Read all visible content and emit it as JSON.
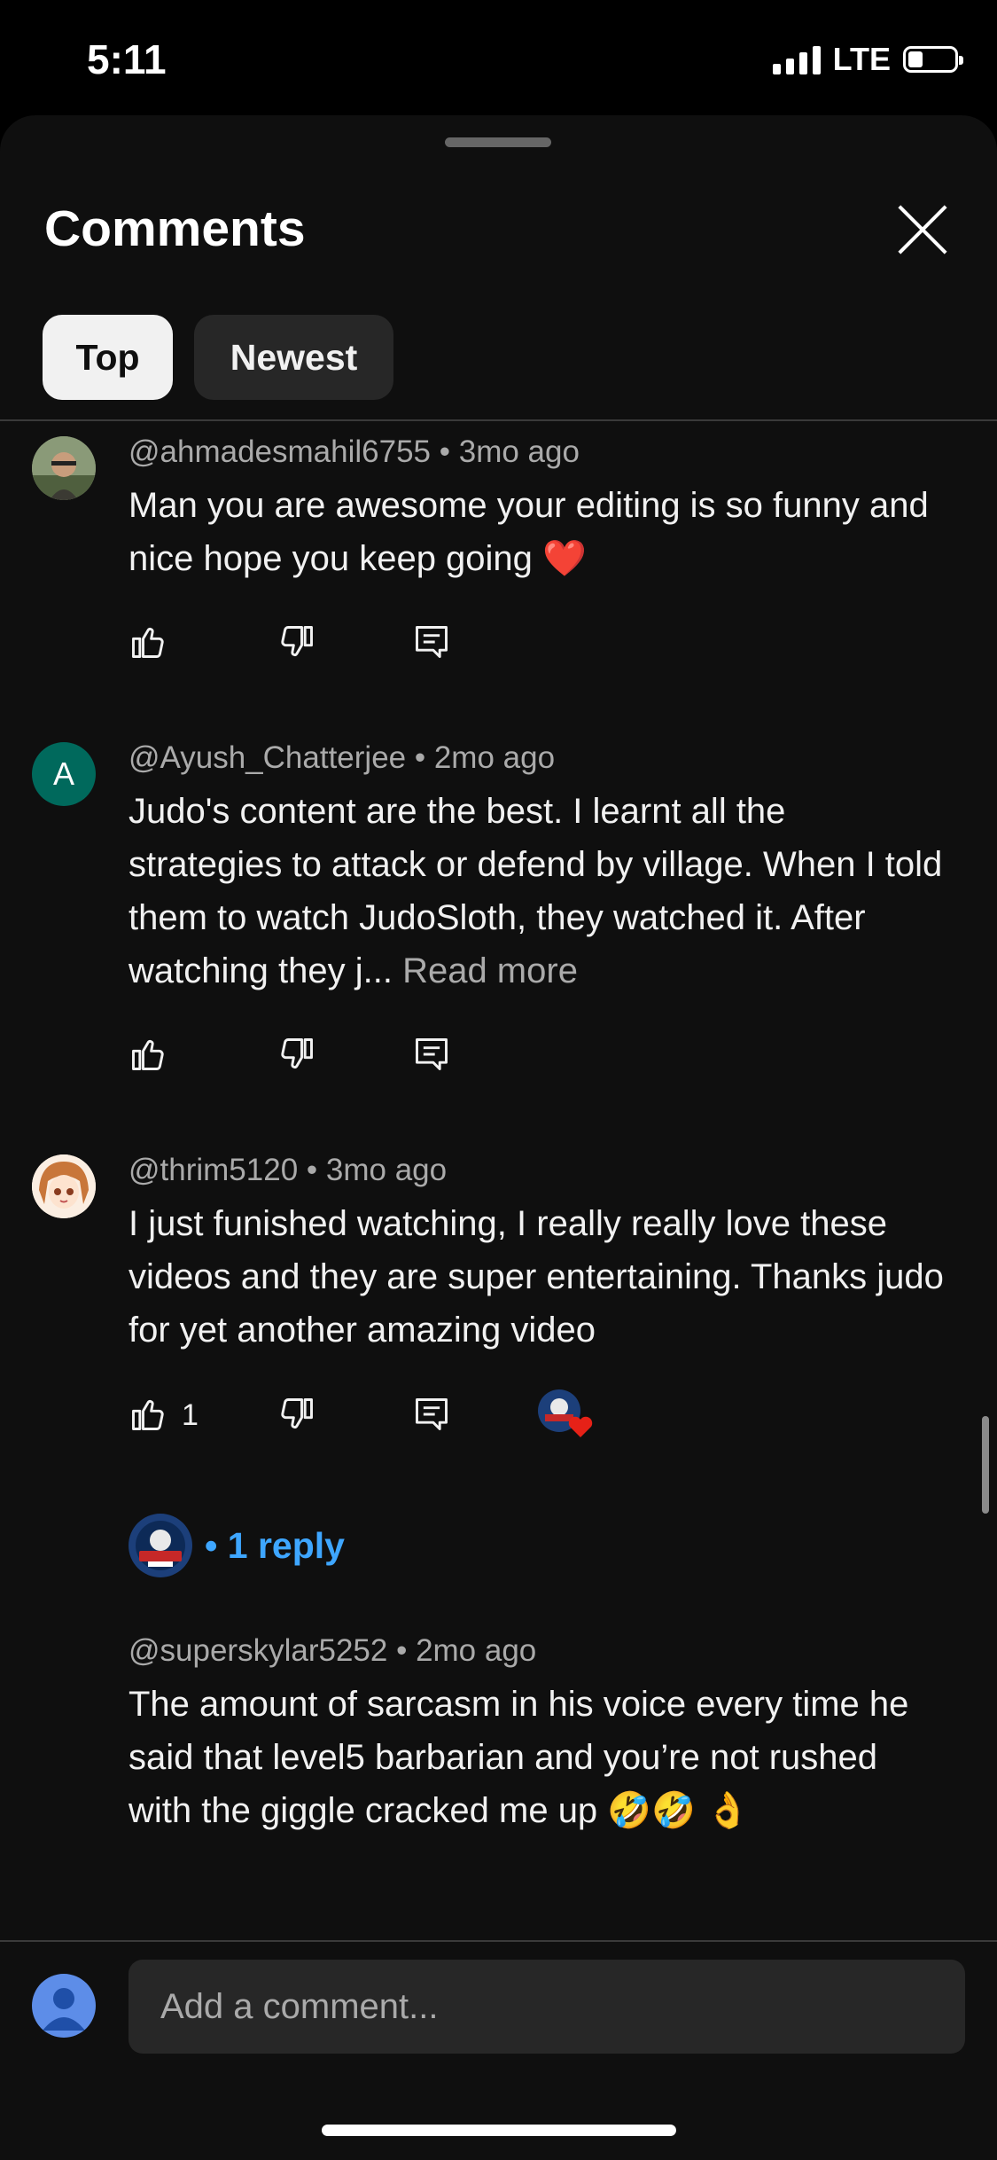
{
  "status_bar": {
    "time": "5:11",
    "network": "LTE"
  },
  "sheet": {
    "title": "Comments"
  },
  "tabs": [
    {
      "label": "Top",
      "selected": true
    },
    {
      "label": "Newest",
      "selected": false
    }
  ],
  "comments": [
    {
      "author": "@ahmadesmahil6755",
      "time": "3mo ago",
      "text": "Man you are awesome your editing is so funny and nice hope you keep going ❤️"
    },
    {
      "author": "@Ayush_Chatterjee",
      "avatar_letter": "A",
      "time": "2mo ago",
      "text": "Judo's content are the best. I learnt all the strategies to attack or defend by village. When I told them to watch JudoSloth, they watched it. After watching they j...",
      "read_more": "Read more"
    },
    {
      "author": "@thrim5120",
      "time": "3mo ago",
      "text": "I just funished watching, I really really love these videos and they are super entertaining. Thanks judo for yet another amazing video",
      "likes": "1",
      "replies_label": "• 1 reply"
    },
    {
      "author": "@superskylar5252",
      "time": "2mo ago",
      "text": "The amount of sarcasm in his voice every time he said that level5 barbarian and you’re not rushed with the giggle cracked me up 🤣🤣 👌"
    }
  ],
  "composer": {
    "placeholder": "Add a comment..."
  },
  "colors": {
    "background": "#0f0f0f",
    "link": "#3ea6ff",
    "chip_selected": "#f1f1f1",
    "chip": "#272727",
    "heart": "#e62117"
  }
}
